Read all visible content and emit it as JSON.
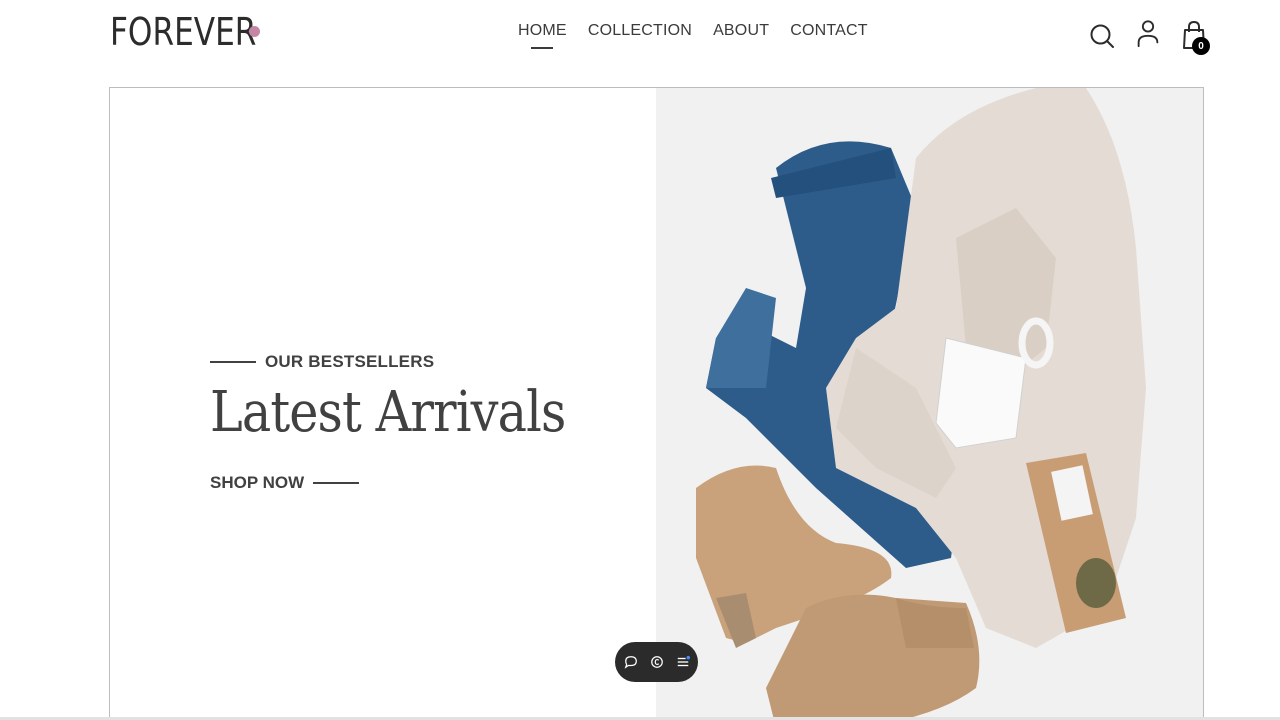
{
  "brand": {
    "name": "FOREVER",
    "dot_color": "#c586a5"
  },
  "nav": {
    "items": [
      {
        "label": "HOME",
        "active": true
      },
      {
        "label": "COLLECTION",
        "active": false
      },
      {
        "label": "ABOUT",
        "active": false
      },
      {
        "label": "CONTACT",
        "active": false
      }
    ]
  },
  "header_icons": {
    "search": "search-icon",
    "profile": "user-icon",
    "cart": "shopping-bag-icon",
    "cart_count": "0"
  },
  "hero": {
    "tag": "OUR BESTSELLERS",
    "title": "Latest Arrivals",
    "cta": "SHOP NOW",
    "image_subject": "flat-lay of jeans, knit sweater, mug, boots, tea bag"
  },
  "floating_toolbar": {
    "icons": [
      "chat-icon",
      "copyright-icon",
      "menu-icon"
    ],
    "accent": "#4a8cff"
  },
  "colors": {
    "text_dark": "#414141",
    "badge": "#000000",
    "border": "#bdbdbd"
  }
}
